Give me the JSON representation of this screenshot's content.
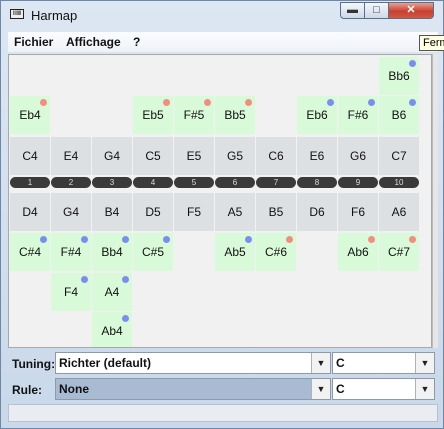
{
  "window": {
    "title": "Harmap",
    "icon_text": "IIIIIII",
    "minimize_glyph": "▬",
    "maximize_glyph": "□",
    "close_glyph": "✕"
  },
  "menu": [
    {
      "label": "Fichier"
    },
    {
      "label": "Affichage"
    },
    {
      "label": "?"
    }
  ],
  "tooltip": "Ferm",
  "rows": {
    "top3": [
      "",
      "",
      "",
      "",
      "",
      "",
      "",
      "",
      "",
      "Bb6"
    ],
    "top2": [
      "",
      "",
      "",
      "",
      "",
      "",
      "",
      "",
      "",
      ""
    ],
    "top1": [
      "Eb4",
      "",
      "",
      "Eb5",
      "F#5",
      "Bb5",
      "",
      "Eb6",
      "F#6",
      "B6"
    ],
    "blow": [
      "C4",
      "E4",
      "G4",
      "C5",
      "E5",
      "G5",
      "C6",
      "E6",
      "G6",
      "C7"
    ],
    "holes": [
      "1",
      "2",
      "3",
      "4",
      "5",
      "6",
      "7",
      "8",
      "9",
      "10"
    ],
    "draw": [
      "D4",
      "G4",
      "B4",
      "D5",
      "F5",
      "A5",
      "B5",
      "D6",
      "F6",
      "A6"
    ],
    "bottom1": [
      "C#4",
      "F#4",
      "Bb4",
      "C#5",
      "",
      "Ab5",
      "C#6",
      "",
      "Ab6",
      "C#7"
    ],
    "bottom2": [
      "",
      "F4",
      "A4",
      "",
      "",
      "",
      "",
      "",
      "",
      ""
    ],
    "bottom3": [
      "",
      "",
      "Ab4",
      "",
      "",
      "",
      "",
      "",
      "",
      ""
    ]
  },
  "dots": {
    "top3": [
      "",
      "",
      "",
      "",
      "",
      "",
      "",
      "",
      "",
      "blue"
    ],
    "top1": [
      "red",
      "",
      "",
      "red",
      "red",
      "red",
      "",
      "blue",
      "blue",
      "blue"
    ],
    "bottom1": [
      "blue",
      "blue",
      "blue",
      "blue",
      "",
      "blue",
      "red",
      "",
      "red",
      "red"
    ],
    "bottom2": [
      "",
      "blue",
      "blue",
      "",
      "",
      "",
      "",
      "",
      "",
      ""
    ],
    "bottom3": [
      "",
      "",
      "blue",
      "",
      "",
      "",
      "",
      "",
      "",
      ""
    ]
  },
  "tuning": {
    "label": "Tuning:",
    "value": "Richter (default)",
    "key": "C"
  },
  "rule": {
    "label": "Rule:",
    "value": "None",
    "key": "C"
  },
  "colors": {
    "dot_blue": "#7b8ef0",
    "dot_red": "#f28d80",
    "bend_cell": "#d9fad9",
    "note_cell": "#dde0e3"
  }
}
